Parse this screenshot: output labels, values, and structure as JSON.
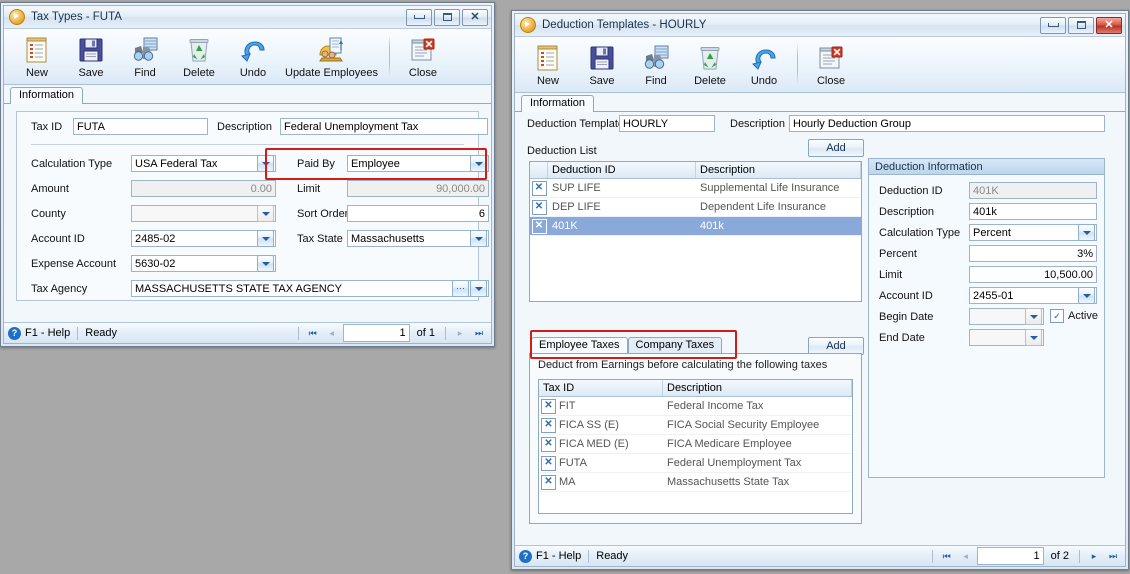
{
  "desktop": {
    "background": "#a8a8a8"
  },
  "left_window": {
    "title": "Tax Types - FUTA",
    "window_buttons": {
      "minimize": "minimize-button",
      "maximize": "restore-button",
      "close": "close-button"
    },
    "toolbar": [
      {
        "name": "new",
        "label": "New",
        "icon": "new-document-icon"
      },
      {
        "name": "save",
        "label": "Save",
        "icon": "floppy-disk-icon"
      },
      {
        "name": "find",
        "label": "Find",
        "icon": "binoculars-icon"
      },
      {
        "name": "delete",
        "label": "Delete",
        "icon": "recycle-bin-icon"
      },
      {
        "name": "undo",
        "label": "Undo",
        "icon": "undo-arrow-icon"
      },
      {
        "name": "update-employees",
        "label": "Update Employees",
        "icon": "update-employees-icon"
      },
      {
        "name": "close",
        "label": "Close",
        "icon": "close-window-icon"
      }
    ],
    "tabs": [
      {
        "label": "Information",
        "selected": true
      }
    ],
    "fields": {
      "tax_id_label": "Tax ID",
      "tax_id_value": "FUTA",
      "description_label": "Description",
      "description_value": "Federal Unemployment Tax",
      "calculation_type_label": "Calculation Type",
      "calculation_type_value": "USA Federal Tax",
      "paid_by_label": "Paid By",
      "paid_by_value": "Employee",
      "amount_label": "Amount",
      "amount_value": "0.00",
      "limit_label": "Limit",
      "limit_value": "90,000.00",
      "county_label": "County",
      "county_value": "",
      "sort_order_label": "Sort Order",
      "sort_order_value": "6",
      "account_id_label": "Account ID",
      "account_id_value": "2485-02",
      "tax_state_label": "Tax State",
      "tax_state_value": "Massachusetts",
      "expense_account_label": "Expense Account",
      "expense_account_value": "5630-02",
      "tax_agency_label": "Tax Agency",
      "tax_agency_value": "MASSACHUSETTS STATE TAX AGENCY"
    },
    "status": {
      "help": "F1 - Help",
      "state": "Ready",
      "page_current": "1",
      "page_of": "of 1"
    }
  },
  "right_window": {
    "title": "Deduction Templates - HOURLY",
    "toolbar": [
      {
        "name": "new",
        "label": "New",
        "icon": "new-document-icon"
      },
      {
        "name": "save",
        "label": "Save",
        "icon": "floppy-disk-icon"
      },
      {
        "name": "find",
        "label": "Find",
        "icon": "binoculars-icon"
      },
      {
        "name": "delete",
        "label": "Delete",
        "icon": "recycle-bin-icon"
      },
      {
        "name": "undo",
        "label": "Undo",
        "icon": "undo-arrow-icon"
      },
      {
        "name": "close",
        "label": "Close",
        "icon": "close-window-icon"
      }
    ],
    "tabs": [
      {
        "label": "Information",
        "selected": true
      }
    ],
    "header": {
      "deduction_template_label": "Deduction Template",
      "deduction_template_value": "HOURLY",
      "description_label": "Description",
      "description_value": "Hourly Deduction Group"
    },
    "deduction_list": {
      "title": "Deduction List",
      "add_label": "Add",
      "columns": [
        "",
        "Deduction ID",
        "Description"
      ],
      "rows": [
        {
          "id": "SUP LIFE",
          "description": "Supplemental Life Insurance",
          "selected": false
        },
        {
          "id": "DEP LIFE",
          "description": "Dependent Life Insurance",
          "selected": false
        },
        {
          "id": "401K",
          "description": "401k",
          "selected": true
        }
      ]
    },
    "deduction_information": {
      "title": "Deduction Information",
      "deduction_id_label": "Deduction ID",
      "deduction_id_value": "401K",
      "description_label": "Description",
      "description_value": "401k",
      "calculation_type_label": "Calculation Type",
      "calculation_type_value": "Percent",
      "percent_label": "Percent",
      "percent_value": "3%",
      "limit_label": "Limit",
      "limit_value": "10,500.00",
      "account_id_label": "Account ID",
      "account_id_value": "2455-01",
      "begin_date_label": "Begin Date",
      "begin_date_value": "",
      "end_date_label": "End Date",
      "end_date_value": "",
      "active_label": "Active",
      "active_checked": true
    },
    "taxes_section": {
      "tabs": [
        {
          "label": "Employee Taxes",
          "selected": true
        },
        {
          "label": "Company Taxes",
          "selected": false
        }
      ],
      "add_label": "Add",
      "note": "Deduct from Earnings before calculating the following taxes",
      "columns": [
        "",
        "Tax ID",
        "Description"
      ],
      "rows": [
        {
          "id": "FIT",
          "description": "Federal Income Tax"
        },
        {
          "id": "FICA SS (E)",
          "description": "FICA Social Security Employee"
        },
        {
          "id": "FICA MED (E)",
          "description": "FICA Medicare Employee"
        },
        {
          "id": "FUTA",
          "description": "Federal Unemployment Tax"
        },
        {
          "id": "MA",
          "description": "Massachusetts State Tax"
        }
      ]
    },
    "status": {
      "help": "F1 - Help",
      "state": "Ready",
      "page_current": "1",
      "page_of": "of 2"
    }
  },
  "annotations": {
    "highlight_color": "#d41c17",
    "boxes": [
      "paid-by-highlight",
      "taxes-tabs-highlight"
    ]
  }
}
